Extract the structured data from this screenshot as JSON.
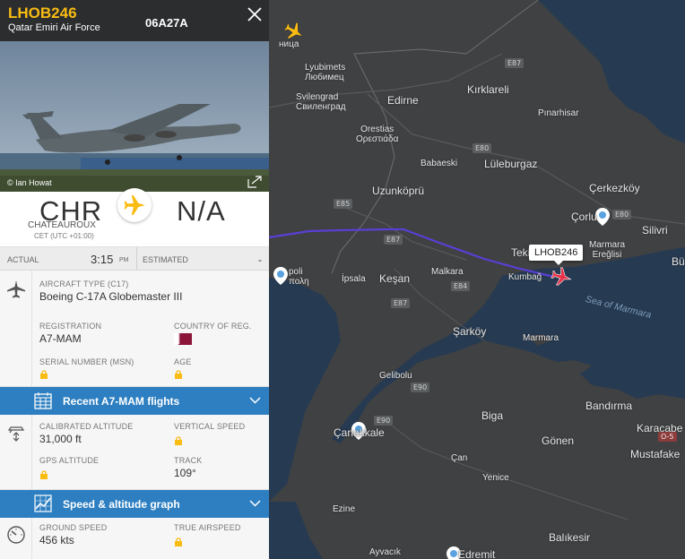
{
  "flight": {
    "callsign": "LHOB246",
    "operator": "Qatar Emiri Air Force",
    "hex": "06A27A",
    "photo_credit": "© Ian Howat"
  },
  "route": {
    "origin_code": "CHR",
    "origin_city": "CHATEAUROUX",
    "origin_tz": "CET (UTC +01:00)",
    "destination_code": "N/A"
  },
  "times": {
    "actual_label": "ACTUAL",
    "actual_value": "3:15",
    "actual_ampm": "PM",
    "estimated_label": "ESTIMATED",
    "estimated_value": "-"
  },
  "aircraft": {
    "type_label": "AIRCRAFT TYPE",
    "type_code": "(C17)",
    "type_value": "Boeing C-17A Globemaster III",
    "registration_label": "REGISTRATION",
    "registration_value": "A7-MAM",
    "country_label": "COUNTRY OF REG.",
    "serial_label": "SERIAL NUMBER (MSN)",
    "age_label": "AGE"
  },
  "recent_flights_label": "Recent A7-MAM flights",
  "altitude": {
    "calibrated_label": "CALIBRATED ALTITUDE",
    "calibrated_value": "31,000 ft",
    "vertical_speed_label": "VERTICAL SPEED",
    "gps_label": "GPS ALTITUDE",
    "track_label": "TRACK",
    "track_value": "109°"
  },
  "graph_label": "Speed & altitude graph",
  "speed": {
    "ground_label": "GROUND SPEED",
    "ground_value": "456 kts",
    "true_label": "TRUE AIRSPEED"
  },
  "map": {
    "labels": [
      {
        "text": "Lyubimets",
        "sub": "Любимец"
      },
      {
        "text": "Svilengrad",
        "sub": "Свиленград"
      },
      {
        "text": "Edirne"
      },
      {
        "text": "Kırklareli"
      },
      {
        "text": "Pınarhisar"
      },
      {
        "text": "Orestias",
        "sub": "Ορεστιάδα"
      },
      {
        "text": "Babaeski"
      },
      {
        "text": "Lüleburgaz"
      },
      {
        "text": "Uzunköprü"
      },
      {
        "text": "Çerkezköy"
      },
      {
        "text": "Çorlu"
      },
      {
        "text": "Silivri"
      },
      {
        "text": "Marmara",
        "sub": "Ereğlisi"
      },
      {
        "text": "Bü"
      },
      {
        "text": "Keşan"
      },
      {
        "text": "Malkara"
      },
      {
        "text": "Tekirdağ"
      },
      {
        "text": "Kumbağ"
      },
      {
        "text": "İpsala"
      },
      {
        "text": "poli",
        "sub": "πολη"
      },
      {
        "text": "Şarköy"
      },
      {
        "text": "Marmara"
      },
      {
        "text": "Gelibolu"
      },
      {
        "text": "Çanakkale"
      },
      {
        "text": "Biga"
      },
      {
        "text": "Bandırma"
      },
      {
        "text": "Gönen"
      },
      {
        "text": "Karacabe"
      },
      {
        "text": "Mustafake"
      },
      {
        "text": "Çan"
      },
      {
        "text": "Yenice"
      },
      {
        "text": "Ezine"
      },
      {
        "text": "Balıkesir"
      },
      {
        "text": "Ayvacık"
      },
      {
        "text": "Edremit"
      },
      {
        "text": "Sea of Marmara"
      },
      {
        "text": "ница"
      }
    ],
    "roads": [
      "E87",
      "E80",
      "E85",
      "E87",
      "E84",
      "E87",
      "E90",
      "E90",
      "E80",
      "O-5"
    ],
    "callout": "LHOB246"
  }
}
